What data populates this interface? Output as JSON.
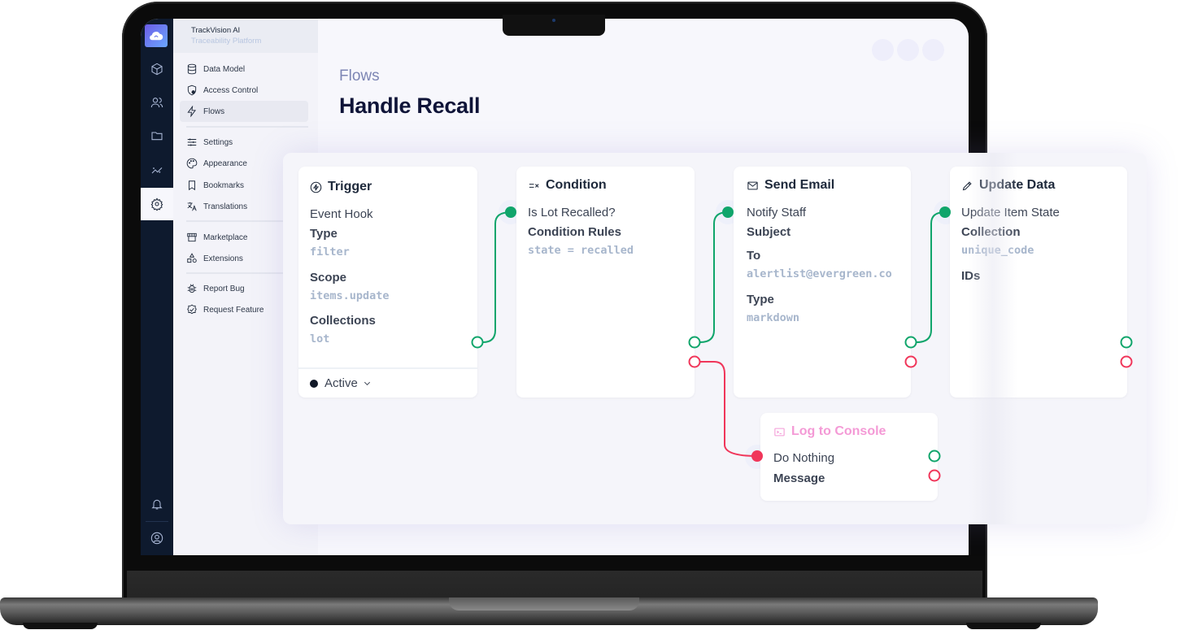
{
  "app": {
    "name": "TrackVision AI",
    "subtitle": "Traceability Platform"
  },
  "rail": {
    "items": [
      {
        "icon": "cube-icon",
        "label": "Content"
      },
      {
        "icon": "users-icon",
        "label": "User Directory"
      },
      {
        "icon": "folder-icon",
        "label": "Files"
      },
      {
        "icon": "insights-icon",
        "label": "Insights"
      },
      {
        "icon": "gear-icon",
        "label": "Settings",
        "active": true
      }
    ],
    "bottom": [
      {
        "icon": "bell-icon",
        "label": "Notifications"
      },
      {
        "icon": "user-circle-icon",
        "label": "Account"
      }
    ]
  },
  "nav": {
    "items": [
      {
        "label": "Data Model",
        "icon": "database-icon"
      },
      {
        "label": "Access Control",
        "icon": "shield-lock-icon"
      },
      {
        "label": "Flows",
        "icon": "bolt-icon",
        "active": true
      },
      {
        "label": "Settings",
        "icon": "sliders-icon"
      },
      {
        "label": "Appearance",
        "icon": "palette-icon"
      },
      {
        "label": "Bookmarks",
        "icon": "bookmark-icon"
      },
      {
        "label": "Translations",
        "icon": "translate-icon"
      },
      {
        "label": "Marketplace",
        "icon": "storefront-icon"
      },
      {
        "label": "Extensions",
        "icon": "shapes-icon"
      },
      {
        "label": "Report Bug",
        "icon": "bug-icon"
      },
      {
        "label": "Request Feature",
        "icon": "verified-icon"
      }
    ]
  },
  "header": {
    "breadcrumb": "Flows",
    "title": "Handle Recall"
  },
  "flow": {
    "trigger": {
      "title": "Trigger",
      "name": "Event Hook",
      "fields": [
        {
          "label": "Type",
          "value": "filter"
        },
        {
          "label": "Scope",
          "value": "items.update"
        },
        {
          "label": "Collections",
          "value": "lot"
        }
      ],
      "status": "Active"
    },
    "condition": {
      "title": "Condition",
      "name": "Is Lot Recalled?",
      "fields": [
        {
          "label": "Condition Rules",
          "value": "state = recalled"
        }
      ]
    },
    "email": {
      "title": "Send Email",
      "name": "Notify Staff",
      "fields": [
        {
          "label": "Subject",
          "value": ""
        },
        {
          "label": "To",
          "value": "alertlist@evergreen.co"
        },
        {
          "label": "Type",
          "value": "markdown"
        }
      ]
    },
    "update": {
      "title": "Update Data",
      "name": "Update Item State",
      "fields": [
        {
          "label": "Collection",
          "value": "unique_code"
        },
        {
          "label": "IDs",
          "value": ""
        }
      ]
    },
    "log": {
      "title": "Log to Console",
      "name": "Do Nothing",
      "fields": [
        {
          "label": "Message",
          "value": ""
        }
      ]
    }
  },
  "colors": {
    "success": "#10a56b",
    "failure": "#f0365a",
    "log_accent": "#f49ad6",
    "rail_bg": "#0e1a2e",
    "title": "#0f1438"
  }
}
